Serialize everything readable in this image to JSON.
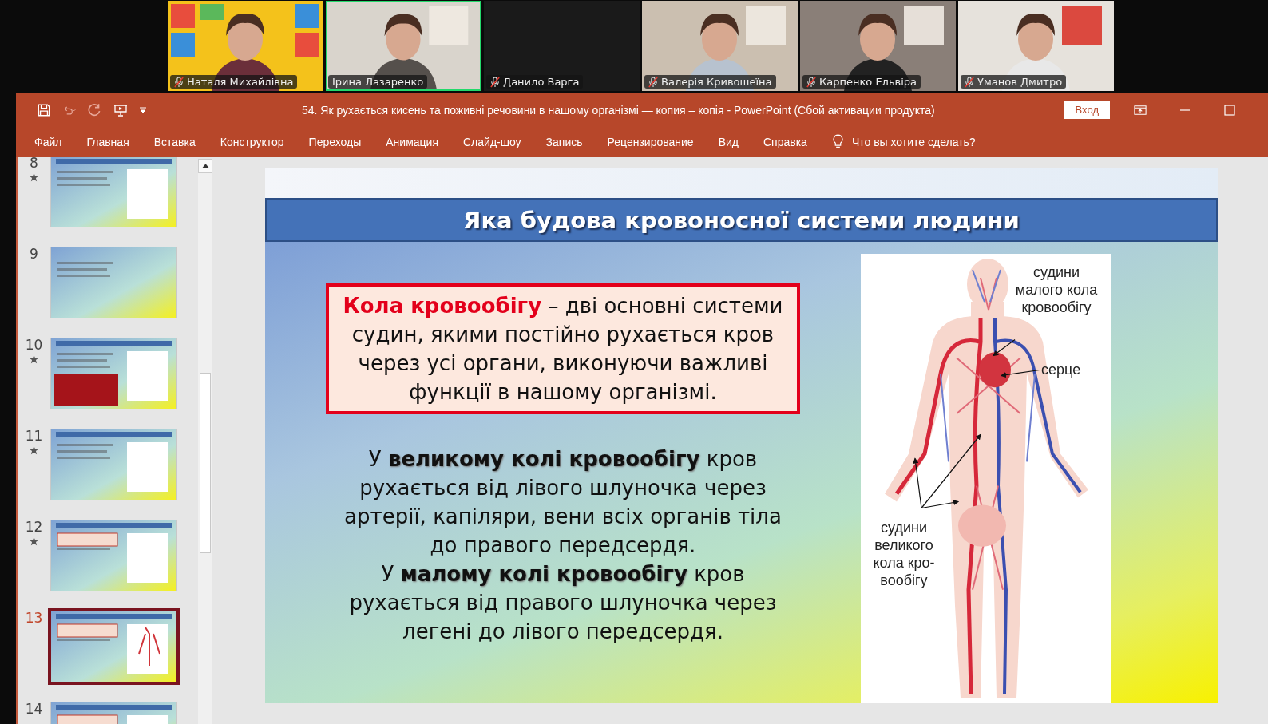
{
  "meeting": {
    "participants": [
      {
        "name": "Наталя Михайлівна",
        "muted": true,
        "video": true,
        "speaking": false
      },
      {
        "name": "Ірина Лазаренко",
        "muted": false,
        "video": true,
        "speaking": true
      },
      {
        "name": "Данило Варга",
        "muted": true,
        "video": false,
        "speaking": false
      },
      {
        "name": "Валерія Кривошеїна",
        "muted": true,
        "video": true,
        "speaking": false
      },
      {
        "name": "Карпенко Ельвіра",
        "muted": true,
        "video": true,
        "speaking": false
      },
      {
        "name": "Уманов Дмитро",
        "muted": true,
        "video": true,
        "speaking": false
      }
    ]
  },
  "window": {
    "title": "54. Як рухається кисень та поживні речовини в нашому організмі — копия – копія  -  PowerPoint (Сбой активации продукта)",
    "sign_in": "Вход"
  },
  "ribbon": {
    "tabs": [
      "Файл",
      "Главная",
      "Вставка",
      "Конструктор",
      "Переходы",
      "Анимация",
      "Слайд-шоу",
      "Запись",
      "Рецензирование",
      "Вид",
      "Справка"
    ],
    "tell_me": "Что вы хотите сделать?"
  },
  "thumbnails": [
    {
      "number": "8",
      "starred": true,
      "selected": false
    },
    {
      "number": "9",
      "starred": false,
      "selected": false
    },
    {
      "number": "10",
      "starred": true,
      "selected": false
    },
    {
      "number": "11",
      "starred": true,
      "selected": false
    },
    {
      "number": "12",
      "starred": true,
      "selected": false
    },
    {
      "number": "13",
      "starred": false,
      "selected": true
    },
    {
      "number": "14",
      "starred": false,
      "selected": false
    }
  ],
  "slide": {
    "title": "Яка будова кровоносної системи людини",
    "definition": "**Кола кровообігу** – дві основні системи судин, якими постійно рухається кров через усі органи, виконуючи важливі функції в нашому організмі.",
    "paragraphs": [
      "У **великому колі кровообігу** кров рухається від лівого шлуночка через артерії, капіляри, вени всіх органів тіла до правого передсердя.",
      "У **малому колі кровообігу** кров рухається від правого шлуночка через легені до лівого передсердя."
    ],
    "figure_labels": [
      "судини малого кола кровообігу",
      "серце",
      "судини великого кола кро-вообігу"
    ]
  }
}
